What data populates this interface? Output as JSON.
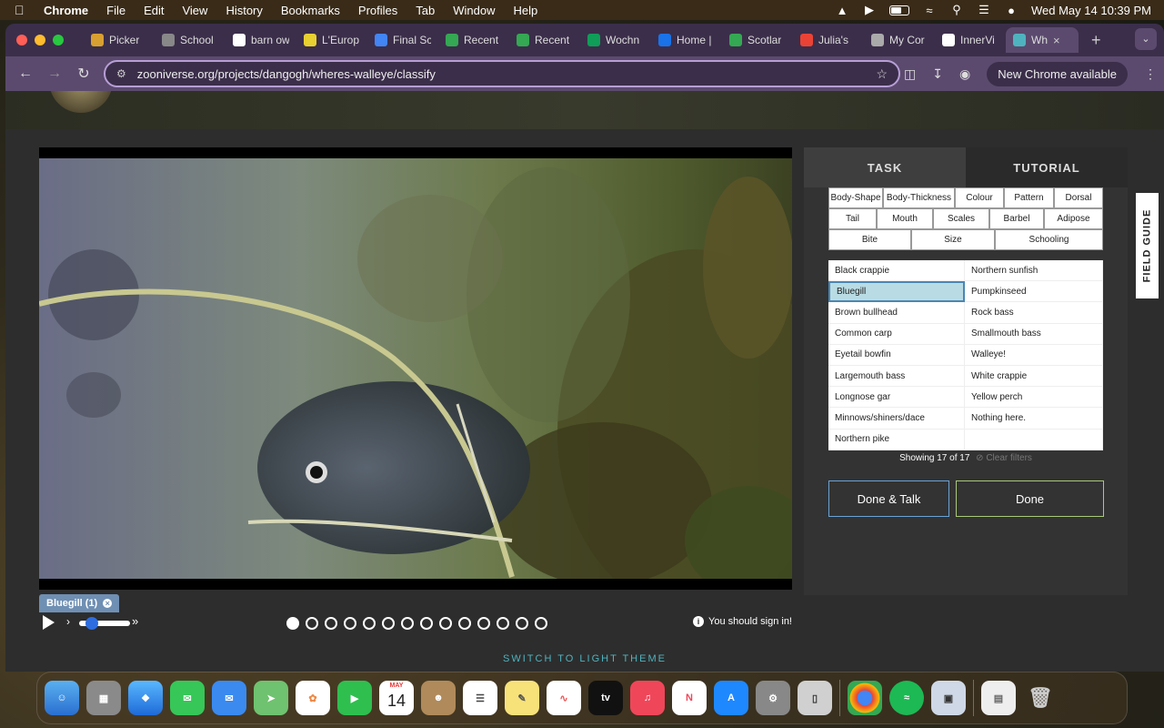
{
  "menubar": {
    "app": "Chrome",
    "items": [
      "File",
      "Edit",
      "View",
      "History",
      "Bookmarks",
      "Profiles",
      "Tab",
      "Window",
      "Help"
    ],
    "datetime": "Wed May 14  10:39 PM",
    "battery_level": 0.6
  },
  "tabs": [
    {
      "label": "Picker",
      "icon": "pinwheel-icon",
      "color": "#d8a030"
    },
    {
      "label": "School",
      "icon": "book-icon",
      "color": "#888888"
    },
    {
      "label": "barn ow",
      "icon": "google-icon",
      "color": "#ffffff"
    },
    {
      "label": "L'Europ",
      "icon": "site-icon",
      "color": "#e8d030"
    },
    {
      "label": "Final Sc",
      "icon": "docs-icon",
      "color": "#4285f4"
    },
    {
      "label": "Recent",
      "icon": "drive-icon",
      "color": "#34a853"
    },
    {
      "label": "Recent",
      "icon": "drive-icon",
      "color": "#34a853"
    },
    {
      "label": "Wochn",
      "icon": "sheets-icon",
      "color": "#0f9d58"
    },
    {
      "label": "Home |",
      "icon": "p-icon",
      "color": "#1a73e8"
    },
    {
      "label": "Scotlar",
      "icon": "drive-icon",
      "color": "#34a853"
    },
    {
      "label": "Julia's",
      "icon": "gmail-icon",
      "color": "#ea4335"
    },
    {
      "label": "My Cor",
      "icon": "globe-icon",
      "color": "#aaaaaa"
    },
    {
      "label": "InnerVi",
      "icon": "face-icon",
      "color": "#ffffff"
    },
    {
      "label": "Wh",
      "icon": "zooniverse-icon",
      "color": "#4fb3bf"
    }
  ],
  "toolbar": {
    "url": "zooniverse.org/projects/dangogh/wheres-walleye/classify",
    "new_chrome": "New Chrome available"
  },
  "viewer": {
    "mark_label": "Bluegill (1)",
    "frames_total": 14,
    "frame_active": 1,
    "speed_level": 0.2,
    "signin_text": "You should sign in!"
  },
  "theme_link": "SWITCH TO LIGHT THEME",
  "panel": {
    "tab_task": "TASK",
    "tab_tutorial": "TUTORIAL",
    "filters_row1": [
      "Body-Shape",
      "Body-Thickness",
      "Colour",
      "Pattern",
      "Dorsal"
    ],
    "filters_row2": [
      "Tail",
      "Mouth",
      "Scales",
      "Barbel",
      "Adipose"
    ],
    "filters_row3": [
      "Bite",
      "Size",
      "Schooling"
    ],
    "species": [
      "Black crappie",
      "Northern sunfish",
      "Bluegill",
      "Pumpkinseed",
      "Brown bullhead",
      "Rock bass",
      "Common carp",
      "Smallmouth bass",
      "Eyetail bowfin",
      "Walleye!",
      "Largemouth bass",
      "White crappie",
      "Longnose gar",
      "Yellow perch",
      "Minnows/shiners/dace",
      "Nothing here.",
      "Northern pike",
      ""
    ],
    "selected_species": "Bluegill",
    "showing": "Showing 17 of 17",
    "clear_filters": "Clear filters",
    "btn_done_talk": "Done & Talk",
    "btn_done": "Done"
  },
  "field_guide": "FIELD GUIDE",
  "dock": {
    "calendar_month": "MAY",
    "calendar_day": "14",
    "tv_label": "tv"
  },
  "colors": {
    "accent_teal": "#4fb3bf",
    "selected_bg": "#b9dce4",
    "chip_blue": "#6f8fb3"
  }
}
